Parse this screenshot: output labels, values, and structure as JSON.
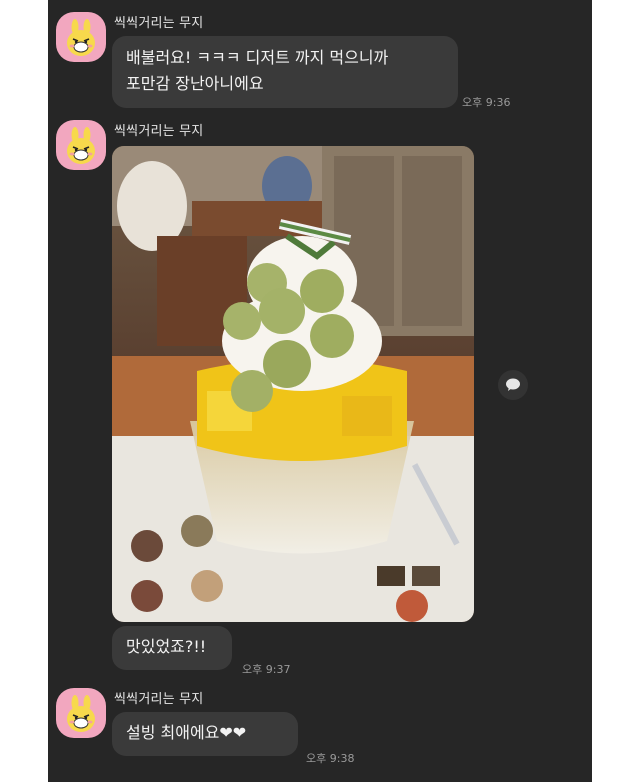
{
  "messages": [
    {
      "sender": "씩씩거리는 무지",
      "text": "배불러요! ㅋㅋㅋ 디저트 까지 먹으니까\n포만감 장난아니에요",
      "time": "오후 9:36"
    },
    {
      "sender": "씩씩거리는 무지",
      "image": "bingsu-photo",
      "text": "맛있었죠?!!",
      "time": "오후 9:37"
    },
    {
      "sender": "씩씩거리는 무지",
      "text": "설빙 최애에요❤❤",
      "time": "오후 9:38"
    }
  ],
  "icons": {
    "avatar": "muzi-avatar-icon",
    "share": "chat-bubble-share-icon"
  },
  "colors": {
    "chat_background": "#262626",
    "bubble": "#3a3a3a",
    "avatar_bg": "#f2a7bf"
  }
}
